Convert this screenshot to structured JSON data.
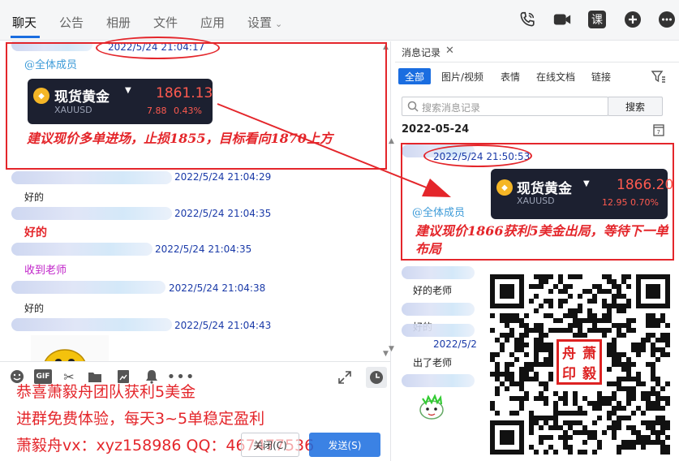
{
  "nav": {
    "tabs": [
      "聊天",
      "公告",
      "相册",
      "文件",
      "应用",
      "设置"
    ],
    "right_icons": [
      "phone-icon",
      "video-call-icon",
      "lesson-icon",
      "add-icon",
      "more-icon"
    ],
    "lesson_label": "课"
  },
  "chat": {
    "top_timestamp": "2022/5/24 21:04:17",
    "at_all": "@全体成员",
    "gold_card": {
      "name": "现货黄金",
      "code": "XAUUSD",
      "price": "1861.13",
      "change": "7.88",
      "change_pct": "0.43%"
    },
    "callout": "建议现价多单进场，止损1855，目标看向1870上方",
    "messages": [
      {
        "time": "2022/5/24 21:04:29",
        "text": "好的",
        "style": "normal"
      },
      {
        "time": "2022/5/24 21:04:35",
        "text": "好的",
        "style": "bold-red"
      },
      {
        "time": "2022/5/24 21:04:35",
        "text": "收到老师",
        "style": "purple"
      },
      {
        "time": "2022/5/24 21:04:38",
        "text": "好的",
        "style": "normal"
      },
      {
        "time": "2022/5/24 21:04:43",
        "text": "",
        "style": "normal"
      }
    ]
  },
  "input": {
    "tool_icons": [
      "emoji-icon",
      "gif-icon",
      "scissors-icon",
      "folder-icon",
      "image-icon",
      "bell-icon",
      "more-icon"
    ],
    "close_label": "关闭(C)",
    "send_label": "发送(S)"
  },
  "footer": {
    "line1": "恭喜萧毅舟团队获利5美金",
    "line2": "进群免费体验，每天3~5单稳定盈利",
    "line3": "萧毅舟vx：xyz158986  QQ：467477536"
  },
  "history": {
    "title": "消息记录",
    "filters": [
      "全部",
      "图片/视频",
      "表情",
      "在线文档",
      "链接"
    ],
    "search_placeholder": "搜索消息记录",
    "search_button": "搜索",
    "date": "2022-05-24",
    "timestamp": "2022/5/24 21:50:53",
    "at_all": "@全体成员",
    "gold_card": {
      "name": "现货黄金",
      "code": "XAUUSD",
      "price": "1866.20",
      "change": "12.95",
      "change_pct": "0.70%"
    },
    "callout": "建议现价1866获利5美金出局，等待下一单布局",
    "messages": [
      {
        "text": "好的老师"
      },
      {
        "text": "好的"
      },
      {
        "text": "2022/5/2"
      },
      {
        "text": "出了老师"
      }
    ]
  },
  "seal": {
    "chars": [
      "舟",
      "萧",
      "印",
      "毅"
    ]
  },
  "colors": {
    "accent": "#1a6de0",
    "annotation": "#e4262b",
    "timestamp": "#1a3aa8"
  }
}
